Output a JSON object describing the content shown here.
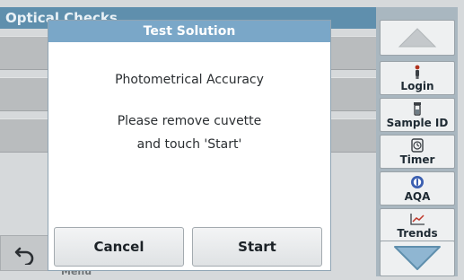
{
  "background": {
    "header_title": "Optical Checks",
    "menu_text": "Menu"
  },
  "dialog": {
    "title": "Test Solution",
    "subtitle": "Photometrical Accuracy",
    "message_line1": "Please remove cuvette",
    "message_line2": "and touch 'Start'",
    "cancel_label": "Cancel",
    "start_label": "Start"
  },
  "sidebar": {
    "login_label": "Login",
    "sample_id_label": "Sample ID",
    "timer_label": "Timer",
    "aqa_label": "AQA",
    "trends_label": "Trends"
  },
  "icons": {
    "scroll_up": "triangle-up-icon",
    "scroll_down": "chevron-down-icon",
    "login": "person-icon",
    "sample_id": "vial-icon",
    "timer": "timer-icon",
    "aqa": "aqa-icon",
    "trends": "trend-chart-icon",
    "back": "back-arrow-icon"
  },
  "colors": {
    "header_blue": "#5f8fad",
    "dialog_title_blue": "#7aa7c8",
    "sidebar_blue": "#a9b7c0",
    "arrow_fill": "#8fb6d2"
  }
}
